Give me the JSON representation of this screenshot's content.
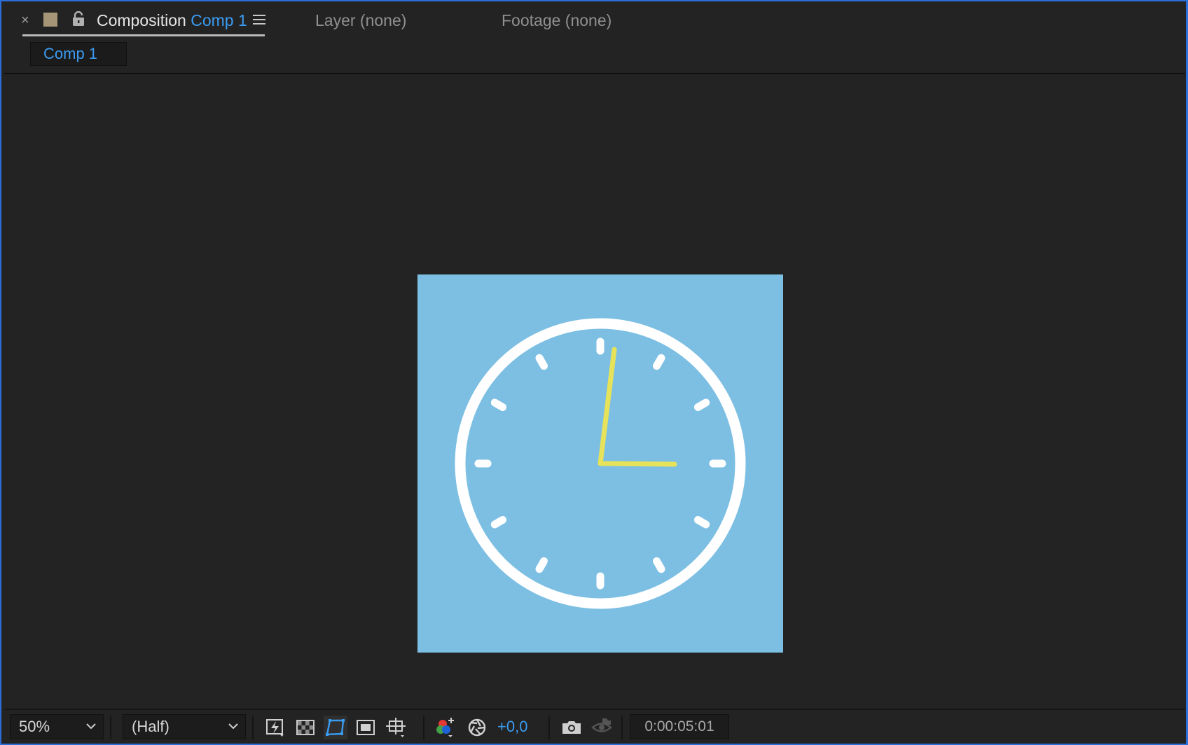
{
  "tabs": {
    "composition": {
      "prefix": "Composition",
      "name": "Comp 1"
    },
    "layer": "Layer (none)",
    "footage": "Footage (none)"
  },
  "breadcrumb": {
    "label": "Comp 1"
  },
  "composition": {
    "background_color": "#7cbfe3",
    "clock": {
      "face_color": "#ffffff",
      "hand_color": "#e6e35a",
      "hour_hand_points_to": 3,
      "minute_hand_points_to_minute": 1
    }
  },
  "toolbar": {
    "magnification": "50%",
    "resolution": "(Half)",
    "exposure": "+0,0",
    "current_time": "0:00:05:01"
  },
  "icons": [
    "close-icon",
    "composition-swatch-icon",
    "lock-icon",
    "panel-menu-icon",
    "fast-previews-icon",
    "transparency-grid-icon",
    "mask-visibility-icon",
    "region-of-interest-icon",
    "guides-grids-icon",
    "color-channels-icon",
    "reset-exposure-icon",
    "snapshot-icon",
    "show-snapshot-icon"
  ],
  "colors": {
    "accent": "#3b9bf0",
    "panel_bg": "#232323",
    "focus_border": "#2d6fd8"
  }
}
